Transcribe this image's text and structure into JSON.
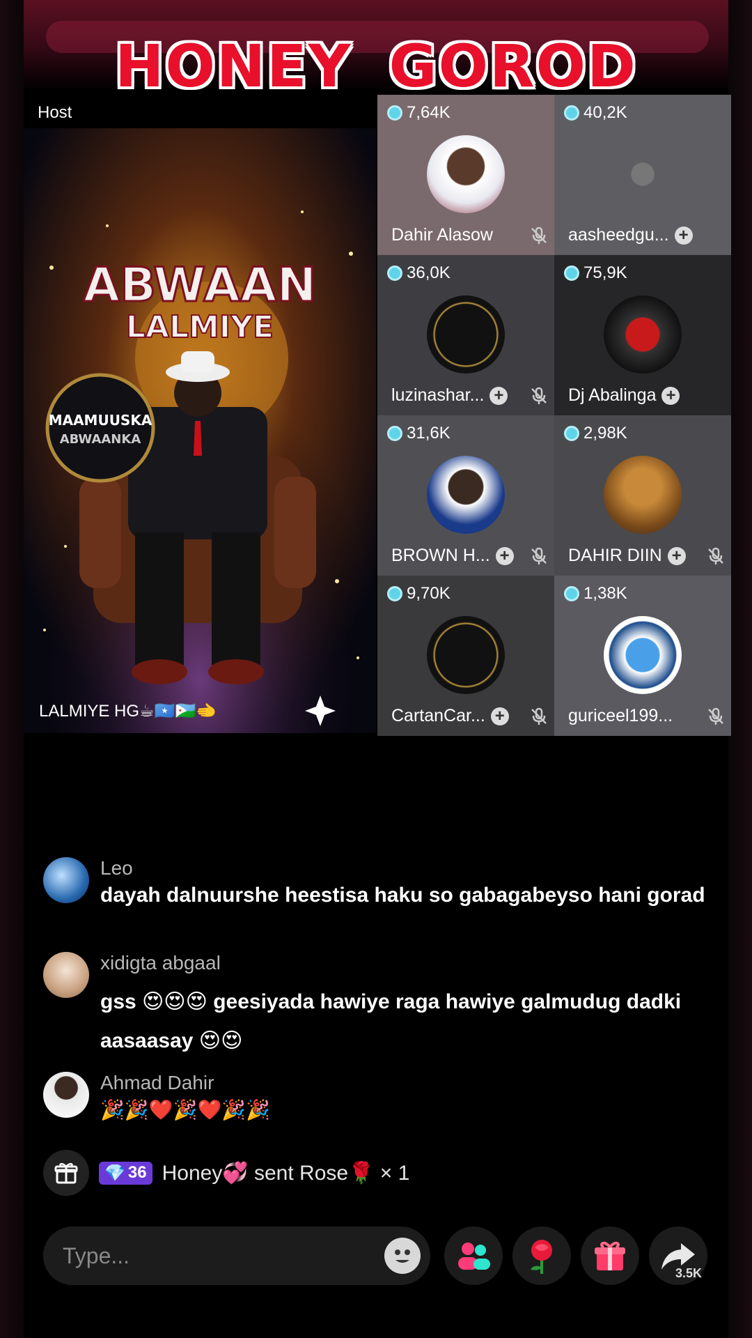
{
  "banner": {
    "title": "HONEY GOROD"
  },
  "host": {
    "label": "Host",
    "name": "LALMIYE HG☕🇸🇴🇩🇯🫲",
    "art_title_1": "ABWAAN",
    "art_title_2": "LALMIYE",
    "art_circle_1": "MAAMUUSKA",
    "art_circle_2": "ABWAANKA"
  },
  "guests": [
    {
      "count": "7,64K",
      "name": "Dahir Alasow",
      "follow": false,
      "muted": true
    },
    {
      "count": "40,2K",
      "name": "aasheedgu...",
      "follow": true,
      "muted": false
    },
    {
      "count": "36,0K",
      "name": "luzinashar...",
      "follow": true,
      "muted": true
    },
    {
      "count": "75,9K",
      "name": "Dj Abalinga",
      "follow": true,
      "muted": false
    },
    {
      "count": "31,6K",
      "name": "BROWN H...",
      "follow": true,
      "muted": true
    },
    {
      "count": "2,98K",
      "name": "DAHIR DIIN",
      "follow": true,
      "muted": true
    },
    {
      "count": "9,70K",
      "name": "CartanCar...",
      "follow": true,
      "muted": true
    },
    {
      "count": "1,38K",
      "name": "guriceel199...",
      "follow": false,
      "muted": true
    }
  ],
  "comments": [
    {
      "user": "Leo",
      "text": "dayah dalnuurshe heestisa haku so gabagabeyso hani gorad"
    },
    {
      "user": "xidigta abgaal",
      "text": "gss 😍😍😍 geesiyada hawiye raga hawiye galmudug dadki aasaasay 😍😍"
    },
    {
      "user": "Ahmad Dahir",
      "text": "🎉🎉❤️🎉❤️🎉🎉"
    }
  ],
  "gift": {
    "level": "36",
    "text": "Honey💞 sent Rose🌹 × 1"
  },
  "input": {
    "placeholder": "Type..."
  },
  "share": {
    "count": "3.5K"
  },
  "icons": {
    "gift": "gift-icon",
    "emoji": "emoji-icon",
    "multi_guest": "multi-guest-icon",
    "rose": "rose-icon",
    "gift_box": "gift-box-icon",
    "share": "share-icon"
  }
}
